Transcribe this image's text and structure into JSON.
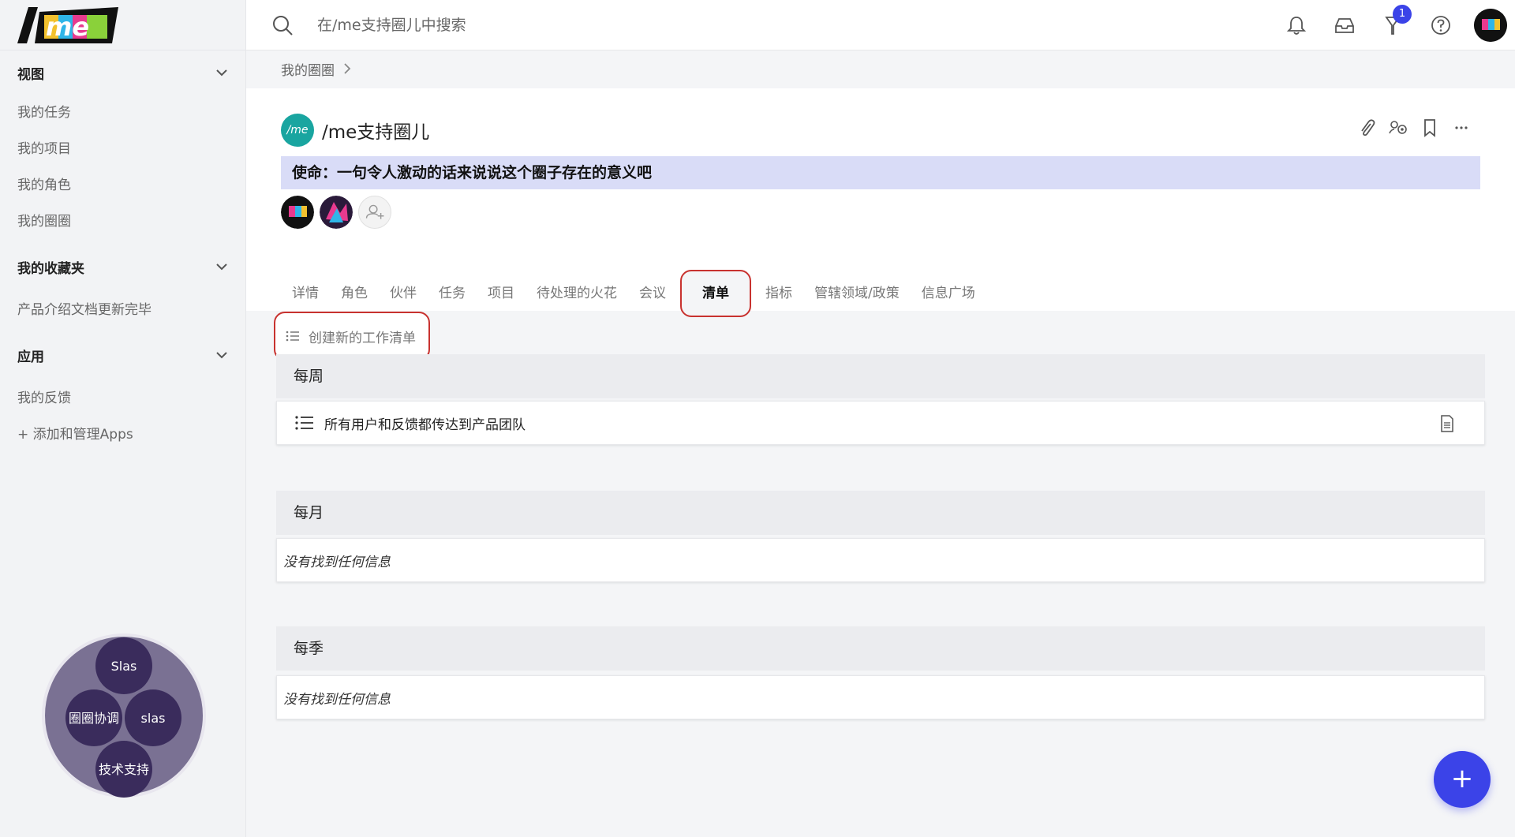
{
  "sidebar": {
    "sections": [
      {
        "label": "视图",
        "items": [
          "我的任务",
          "我的项目",
          "我的角色",
          "我的圈圈"
        ]
      },
      {
        "label": "我的收藏夹",
        "items": [
          "产品介绍文档更新完毕"
        ]
      },
      {
        "label": "应用",
        "items": [
          "我的反馈",
          "+ 添加和管理Apps"
        ]
      }
    ],
    "circle_widget": {
      "nodes": [
        "Slas",
        "圈圈协调",
        "slas",
        "技术支持"
      ]
    }
  },
  "topbar": {
    "search_placeholder": "在/me支持圈儿中搜索",
    "notification_badge": "1"
  },
  "breadcrumb": {
    "item": "我的圈圈"
  },
  "circle": {
    "logo_text": "/me",
    "title": "/me支持圈儿",
    "mission": "使命：一句令人激动的话来说说这个圈子存在的意义吧"
  },
  "tabs": [
    "详情",
    "角色",
    "伙伴",
    "任务",
    "项目",
    "待处理的火花",
    "会议",
    "清单",
    "指标",
    "管辖领域/政策",
    "信息广场"
  ],
  "active_tab": "清单",
  "create_button": "创建新的工作清单",
  "groups": [
    {
      "title": "每周",
      "rows": [
        "所有用户和反馈都传达到产品团队"
      ]
    },
    {
      "title": "每月",
      "empty": "没有找到任何信息"
    },
    {
      "title": "每季",
      "empty": "没有找到任何信息"
    }
  ],
  "fab_label": "+",
  "colors": {
    "accent": "#3b43e8",
    "highlight_border": "#c8322f",
    "mission_bg": "#d9dcf7",
    "circle_logo": "#19a5a0",
    "widget_outer": "#7a7193",
    "widget_node": "#3a2c5c"
  }
}
